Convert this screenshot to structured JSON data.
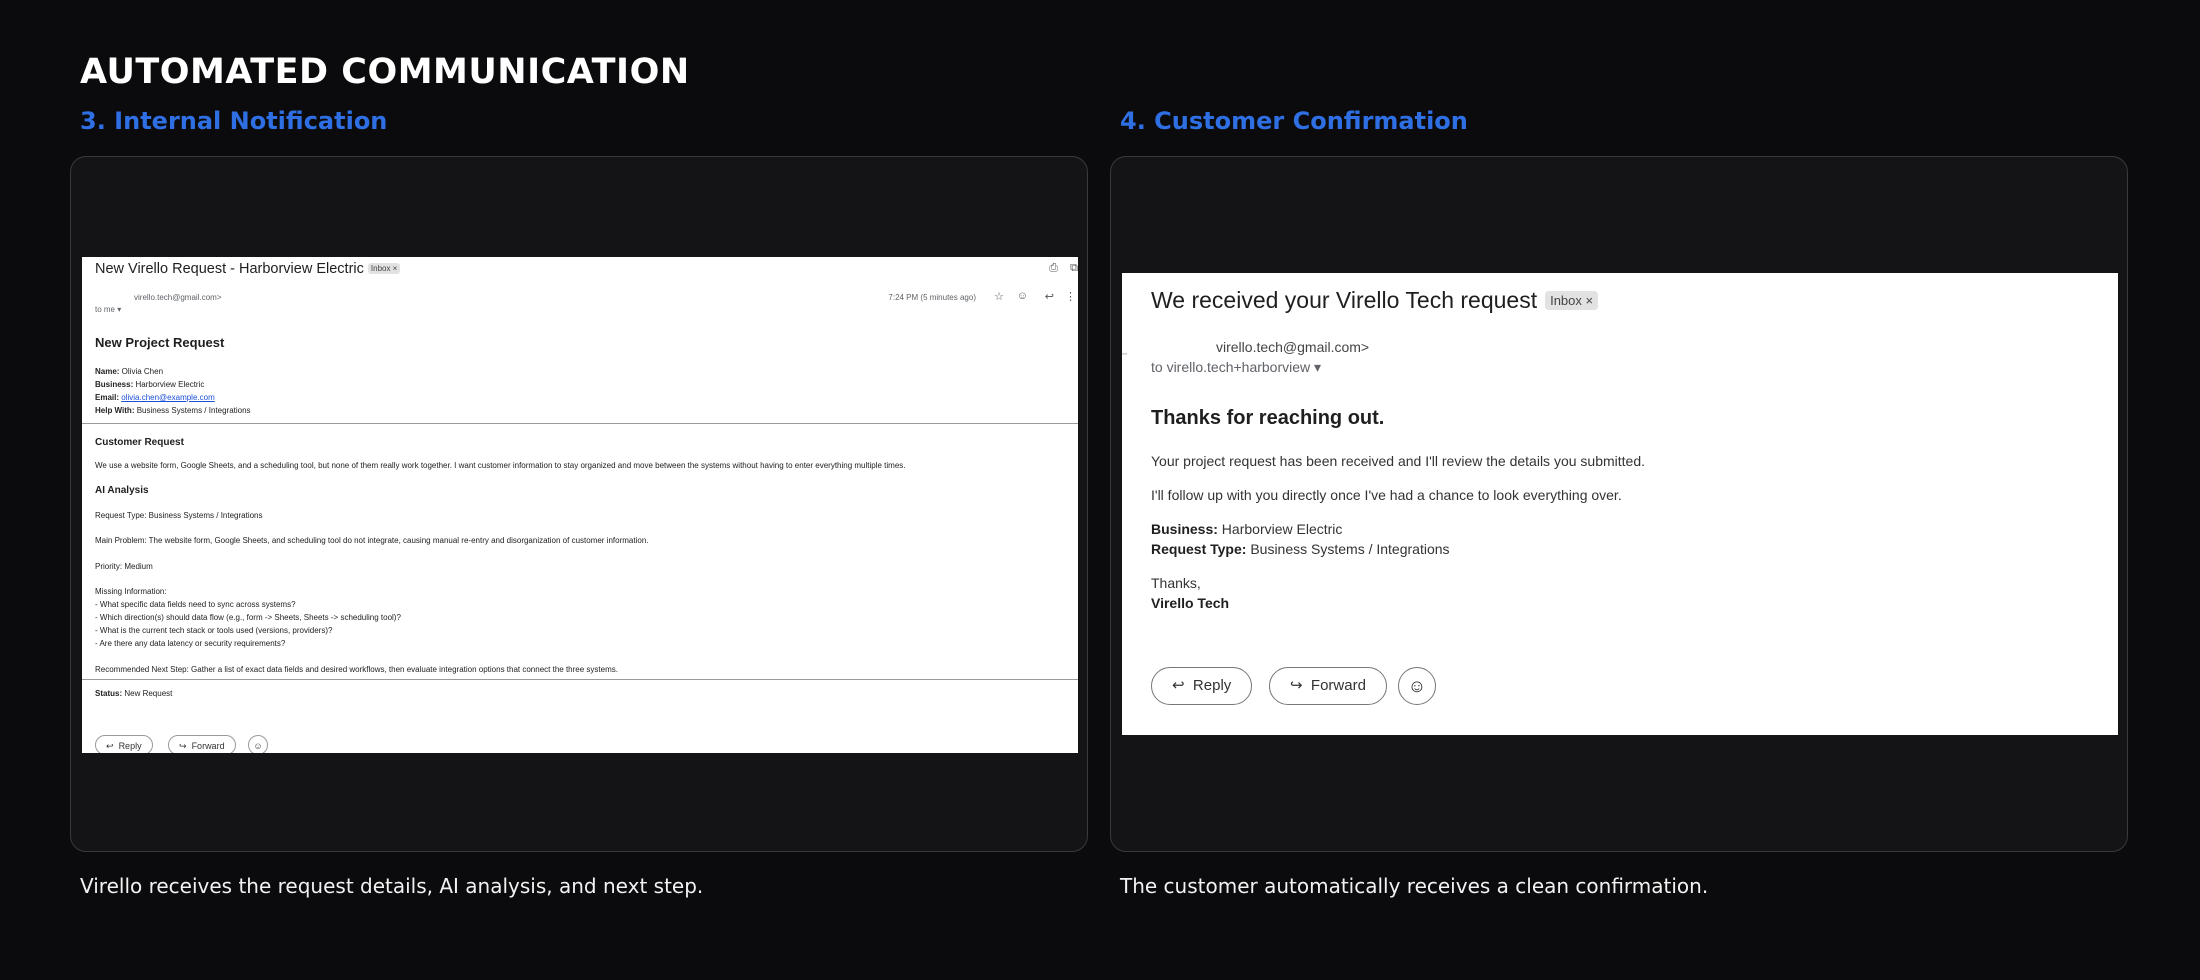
{
  "page": {
    "title": "AUTOMATED COMMUNICATION"
  },
  "sections": [
    {
      "heading": "3. Internal Notification",
      "caption": "Virello receives the request details, AI analysis, and next step."
    },
    {
      "heading": "4. Customer Confirmation",
      "caption": "The customer automatically receives a clean confirmation."
    }
  ],
  "internal_email": {
    "subject": "New Virello Request - Harborview Electric",
    "inbox_chip": "Inbox ×",
    "sender": "virello.tech@gmail.com>",
    "to": "to me ▾",
    "time": "7:24 PM (5 minutes ago)",
    "heading": "New Project Request",
    "fields": [
      {
        "label": "Name:",
        "value": " Olivia Chen"
      },
      {
        "label": "Business:",
        "value": " Harborview Electric"
      },
      {
        "label": "Email:",
        "value": "olivia.chen@example.com"
      },
      {
        "label": "Help With:",
        "value": " Business Systems / Integrations"
      }
    ],
    "customer_request_heading": "Customer Request",
    "customer_request_text": "We use a website form, Google Sheets, and a scheduling tool, but none of them really work together. I want customer information to stay organized and move between the systems without having to enter everything multiple times.",
    "ai_heading": "AI Analysis",
    "request_type": "Request Type: Business Systems / Integrations",
    "main_problem": "Main Problem: The website form, Google Sheets, and scheduling tool do not integrate, causing manual re-entry and disorganization of customer information.",
    "priority": "Priority: Medium",
    "missing_heading": "Missing Information:",
    "missing_items": [
      "- What specific data fields need to sync across systems?",
      "- Which direction(s) should data flow (e.g., form -> Sheets, Sheets -> scheduling tool)?",
      "- What is the current tech stack or tools used (versions, providers)?",
      "- Are there any data latency or security requirements?"
    ],
    "next_step": "Recommended Next Step: Gather a list of exact data fields and desired workflows, then evaluate integration options that connect the three systems.",
    "status_label": "Status:",
    "status_value": " New Request",
    "reply_label": "Reply",
    "forward_label": "Forward"
  },
  "customer_email": {
    "subject": "We received your Virello Tech request",
    "inbox_chip": "Inbox ×",
    "sender": "virello.tech@gmail.com>",
    "to": "to virello.tech+harborview",
    "heading": "Thanks for reaching out.",
    "line1": "Your project request has been received and I'll review the details you submitted.",
    "line2": "I'll follow up with you directly once I've had a chance to look everything over.",
    "business_label": "Business:",
    "business_value": " Harborview Electric",
    "request_type_label": "Request Type:",
    "request_type_value": " Business Systems / Integrations",
    "thanks": "Thanks,",
    "signature": "Virello Tech",
    "reply_label": "Reply",
    "forward_label": "Forward"
  }
}
